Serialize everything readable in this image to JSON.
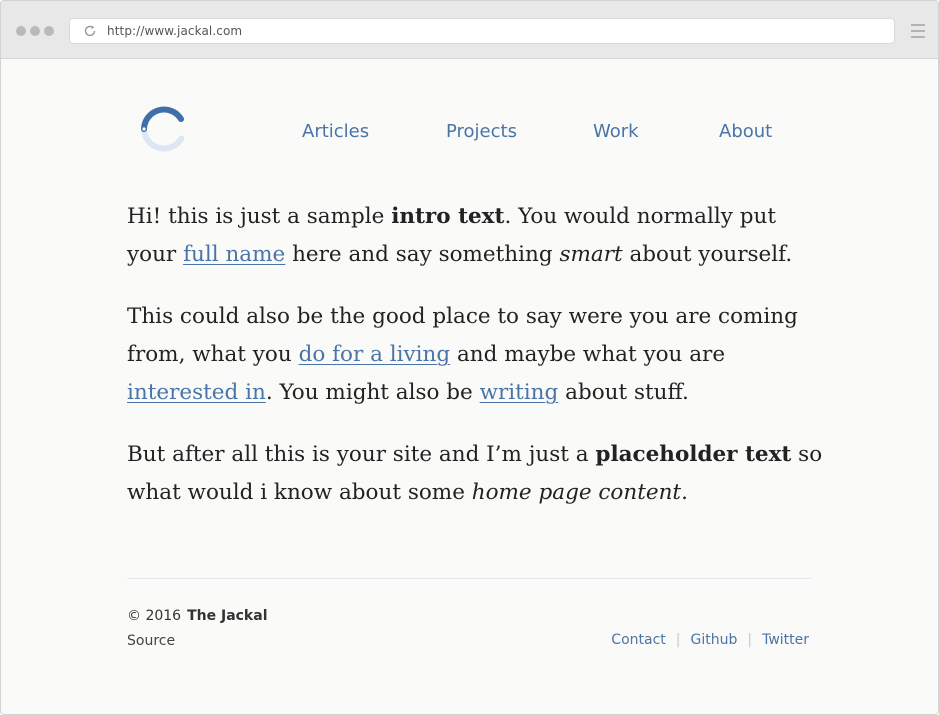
{
  "browser": {
    "url": "http://www.jackal.com"
  },
  "nav": {
    "items": [
      {
        "label": "Articles"
      },
      {
        "label": "Projects"
      },
      {
        "label": "Work"
      },
      {
        "label": "About"
      }
    ]
  },
  "intro": {
    "p1": {
      "t1": "Hi! this is just a sample ",
      "b1": "intro text",
      "t2": ". You would normally put",
      "t3": "your ",
      "a1": "full name",
      "t4": " here and say something ",
      "i1": "smart",
      "t5": " about yourself."
    },
    "p2": {
      "t1": "This could also be the good place to say were you are coming",
      "t2": "from, what you ",
      "a1": "do for a living",
      "t3": " and maybe what you are",
      "a2": "interested in",
      "t4": ". You might also be ",
      "a3": "writing",
      "t5": " about stuff."
    },
    "p3": {
      "t1": "But after all this is your site and I’m just a ",
      "b1": "placeholder text",
      "t2": " so",
      "t3": "what would i know about some ",
      "i1": "home page content",
      "t4": "."
    }
  },
  "footer": {
    "copyright": "© 2016",
    "site_name": "The Jackal",
    "source": "Source",
    "links": [
      {
        "label": "Contact"
      },
      {
        "label": "Github"
      },
      {
        "label": "Twitter"
      }
    ]
  },
  "colors": {
    "link": "#4a74a8",
    "text": "#222222",
    "logo_dark": "#3f6fa6",
    "logo_light": "#dde6f2"
  }
}
